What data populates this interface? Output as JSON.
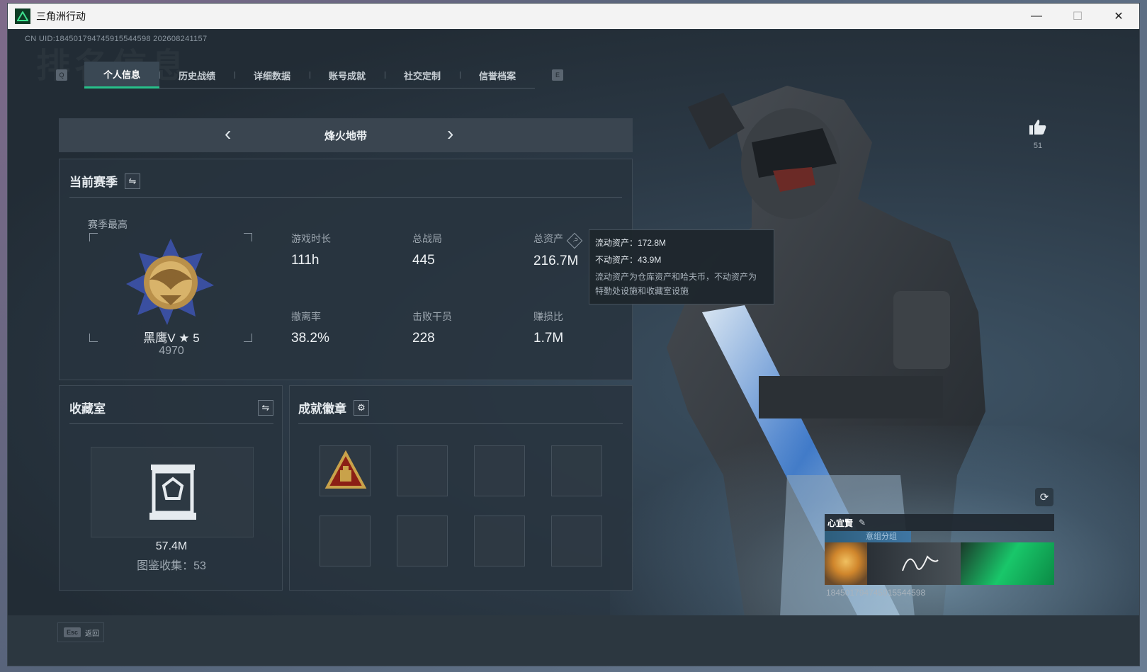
{
  "window": {
    "title": "三角洲行动",
    "minimize_symbol": "—",
    "maximize_symbol": "☐",
    "close_symbol": "✕"
  },
  "uid_text": "CN UID:184501794745915544598 202608241157",
  "watermark_title": "排名信息",
  "tabs": {
    "left_key": "Q",
    "right_key": "E",
    "items": [
      {
        "label": "个人信息",
        "active": true
      },
      {
        "label": "历史战绩",
        "active": false
      },
      {
        "label": "详细数据",
        "active": false
      },
      {
        "label": "账号成就",
        "active": false
      },
      {
        "label": "社交定制",
        "active": false
      },
      {
        "label": "信誉档案",
        "active": false
      }
    ]
  },
  "mode_selector": {
    "title": "烽火地带",
    "prev_symbol": "‹",
    "next_symbol": "›"
  },
  "season": {
    "title": "当前赛季",
    "swap_symbol": "⇋",
    "best_label": "赛季最高",
    "rank_name": "黑鹰V ★ 5",
    "rank_score": "4970",
    "stats": [
      {
        "label": "游戏时长",
        "value": "111h"
      },
      {
        "label": "总战局",
        "value": "445"
      },
      {
        "label": "总资产",
        "value": "216.7M"
      },
      {
        "label": "撤离率",
        "value": "38.2%"
      },
      {
        "label": "击败干员",
        "value": "228"
      },
      {
        "label": "赚损比",
        "value": "1.7M"
      }
    ],
    "help_symbol": "?"
  },
  "tooltip": {
    "liquid": "流动资产：172.8M",
    "fixed": "不动资产：43.9M",
    "note_line1": "流动资产为仓库资产和哈夫币，不动资产为",
    "note_line2": "特勤处设施和收藏室设施"
  },
  "collection": {
    "title": "收藏室",
    "swap_symbol": "⇋",
    "value": "57.4M",
    "count": "图鉴收集：53"
  },
  "badges": {
    "title": "成就徽章",
    "settings_symbol": "⚙",
    "slots": 8,
    "filled_slots": [
      0
    ]
  },
  "likes": {
    "count": "51",
    "icon": "thumbs-up-icon"
  },
  "profile_card": {
    "name": "心宜賢",
    "group": "意组分组",
    "uid": "18450179474591554459​8",
    "refresh_symbol": "⟳",
    "edit_symbol": "✎"
  },
  "footer": {
    "esc_key": "Esc",
    "esc_label": "返回"
  },
  "colors": {
    "accent": "#27c08a",
    "panel": "#28343e",
    "badge_gold": "#c9a24a",
    "badge_red": "#8b1f15"
  }
}
